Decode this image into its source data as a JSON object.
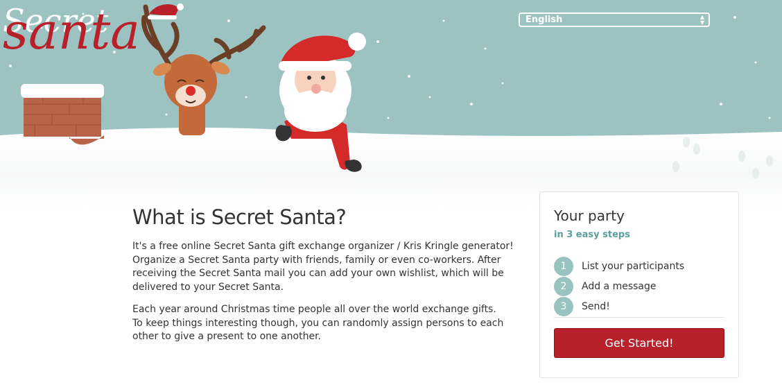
{
  "header": {
    "language": {
      "selected": "English"
    },
    "logo": {
      "line1": "Secret",
      "line2": "santa"
    }
  },
  "intro": {
    "title": "What is Secret Santa?",
    "paragraph1": "It's a free online Secret Santa gift exchange organizer / Kris Kringle generator! Organize a Secret Santa party with friends, family or even co-workers. After receiving the Secret Santa mail you can add your own wishlist, which will be delivered to your Secret Santa.",
    "paragraph2_line1": "Each year around Christmas time people all over the world exchange gifts.",
    "paragraph2_line2": "To keep things interesting though, you can randomly assign persons to each other to give a present to one another."
  },
  "party_card": {
    "title": "Your party",
    "subtitle": "in 3 easy steps",
    "steps": [
      {
        "number": "1",
        "label": "List your participants"
      },
      {
        "number": "2",
        "label": "Add a message"
      },
      {
        "number": "3",
        "label": "Send!"
      }
    ],
    "cta_label": "Get Started!"
  },
  "colors": {
    "sky": "#9cc3c1",
    "accent": "#b8202a",
    "step_circle": "#98c3c0",
    "subtitle": "#5a9e9a"
  },
  "icons": [
    "reindeer-illustration",
    "santa-illustration",
    "chimney-illustration",
    "snowflake-icon",
    "footprint-icon",
    "select-arrows-icon"
  ]
}
